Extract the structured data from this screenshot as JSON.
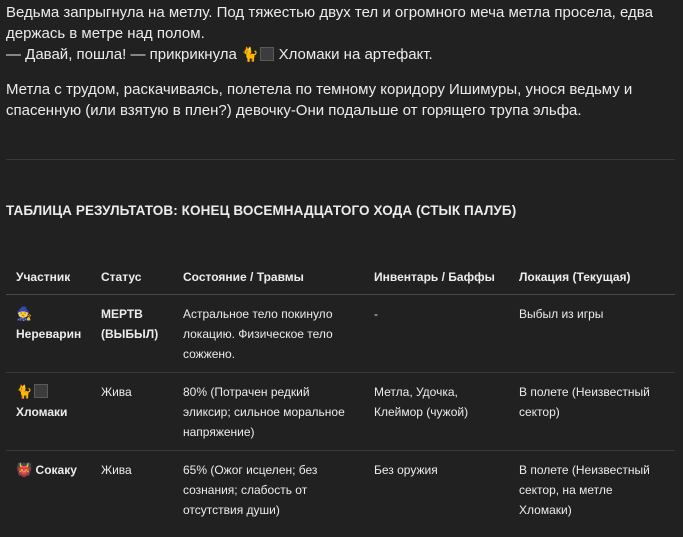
{
  "story": {
    "p1_line1": "Ведьма запрыгнула на метлу. Под тяжестью двух тел и огромного меча метла просела, едва держась в метре над полом.",
    "p1_line2_prefix": "— Давай, пошла! — прикрикнула ",
    "p1_emoji": "🐈",
    "p1_line2_suffix": " Хломаки на артефакт.",
    "p2": "Метла с трудом, раскачиваясь, полетела по темному коридору Ишимуры, унося ведьму и спасенную (или взятую в плен?) девочку-Они подальше от горящего трупа эльфа."
  },
  "results": {
    "heading": "ТАБЛИЦА РЕЗУЛЬТАТОВ: КОНЕЦ ВОСЕМНАДЦАТОГО ХОДА (СТЫК ПАЛУБ)",
    "headers": [
      "Участник",
      "Статус",
      "Состояние / Травмы",
      "Инвентарь / Баффы",
      "Локация (Текущая)"
    ],
    "rows": [
      {
        "emoji": "🧙",
        "name": "Нереварин",
        "status": "МЕРТВ (ВЫБЫЛ)",
        "condition": "Астральное тело покинуло локацию. Физическое тело сожжено.",
        "inventory": "-",
        "location": "Выбыл из игры"
      },
      {
        "emoji": "🐈",
        "name": "Хломаки",
        "status": "Жива",
        "condition": "80% (Потрачен редкий эликсир; сильное моральное напряжение)",
        "inventory": "Метла, Удочка, Клеймор (чужой)",
        "location": "В полете (Неизвестный сектор)"
      },
      {
        "emoji": "👹",
        "name": "Сокаку",
        "status": "Жива",
        "condition": "65% (Ожог исцелен; без сознания; слабость от отсутствия души)",
        "inventory": "Без оружия",
        "location": "В полете (Неизвестный сектор, на метле Хломаки)"
      }
    ]
  }
}
